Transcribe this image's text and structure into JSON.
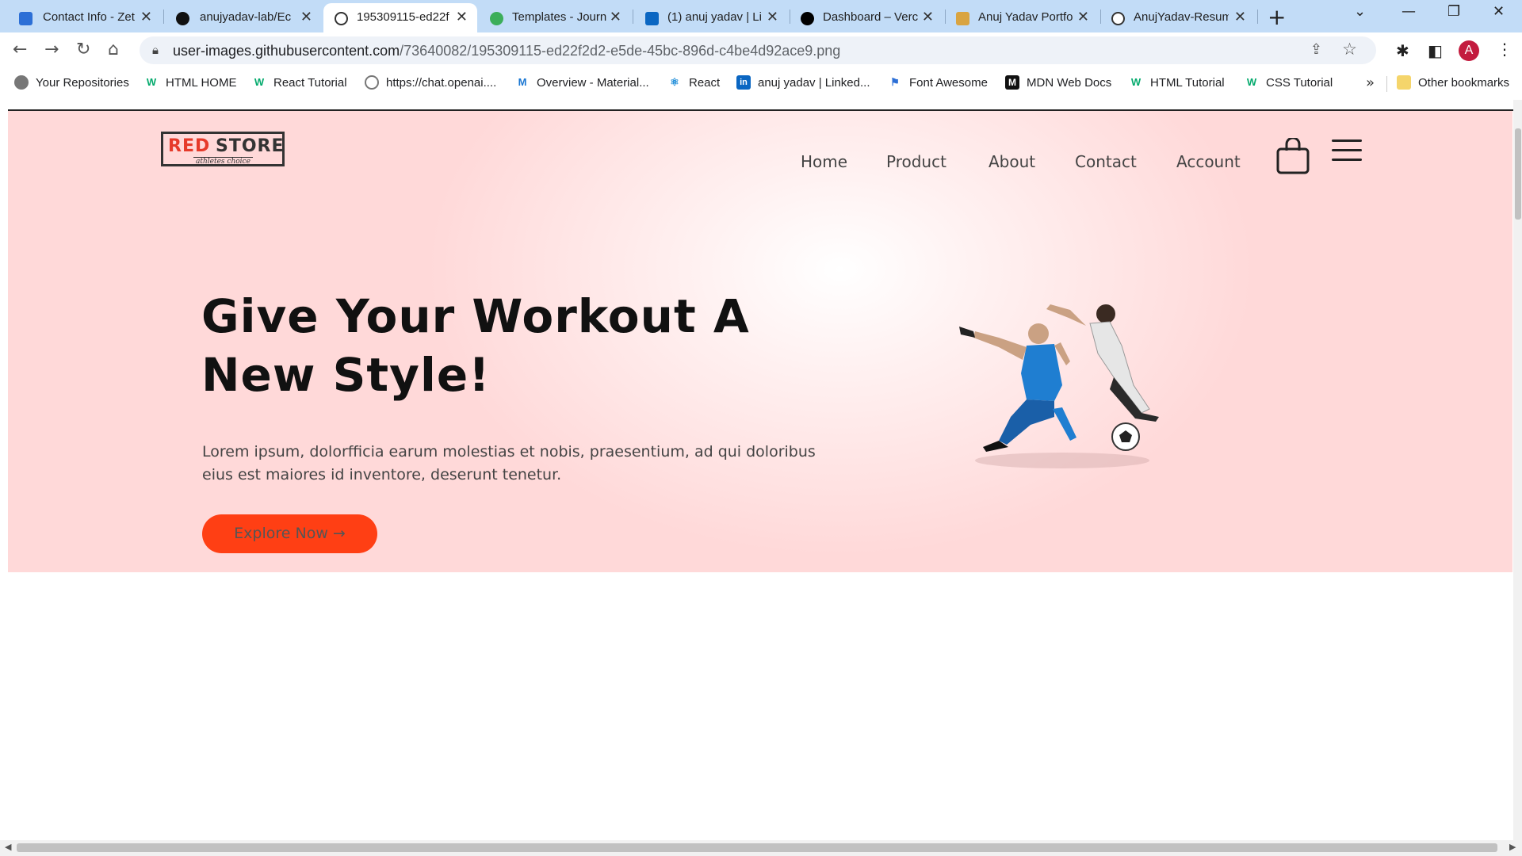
{
  "browser": {
    "tabs": [
      {
        "title": "Contact Info - Zet",
        "favicon": "zety-icon",
        "color": "#2c6fd6"
      },
      {
        "title": "anujyadav-lab/Ec",
        "favicon": "github-icon",
        "color": "#111111"
      },
      {
        "title": "195309115-ed22f",
        "favicon": "globe-icon",
        "color": "#333333",
        "active": true
      },
      {
        "title": "Templates - Journ",
        "favicon": "leaf-icon",
        "color": "#3cae5a"
      },
      {
        "title": "(1) anuj yadav | Li",
        "favicon": "linkedin-icon",
        "color": "#0a66c2"
      },
      {
        "title": "Dashboard – Verc",
        "favicon": "vercel-icon",
        "color": "#000000"
      },
      {
        "title": "Anuj Yadav Portfo",
        "favicon": "portfolio-icon",
        "color": "#d9a441"
      },
      {
        "title": "AnujYadav-Resum",
        "favicon": "globe-icon",
        "color": "#333333"
      }
    ],
    "new_tab_icon": "plus-icon",
    "url_host": "user-images.githubusercontent.com",
    "url_path": "/73640082/195309115-ed22f2d2-e5de-45bc-896d-c4be4d92ace9.png",
    "profile_initial": "A",
    "profile_color": "#c31b3e",
    "bookmarks": [
      {
        "label": "Your Repositories",
        "icon": "github-icon"
      },
      {
        "label": "HTML HOME",
        "icon": "w3schools-icon"
      },
      {
        "label": "React Tutorial",
        "icon": "w3schools-icon"
      },
      {
        "label": "https://chat.openai....",
        "icon": "openai-icon"
      },
      {
        "label": "Overview - Material...",
        "icon": "mui-icon"
      },
      {
        "label": "React",
        "icon": "react-icon"
      },
      {
        "label": "anuj yadav | Linked...",
        "icon": "linkedin-icon"
      },
      {
        "label": "Font Awesome",
        "icon": "flag-icon"
      },
      {
        "label": "MDN Web Docs",
        "icon": "mdn-icon"
      },
      {
        "label": "HTML Tutorial",
        "icon": "w3schools-icon"
      },
      {
        "label": "CSS Tutorial",
        "icon": "w3schools-icon"
      }
    ],
    "bookmarks_overflow": "»",
    "other_bookmarks": "Other bookmarks"
  },
  "site": {
    "logo_red": "RED",
    "logo_store": "STORE",
    "logo_tagline": "athletes choice",
    "nav": [
      "Home",
      "Product",
      "About",
      "Contact",
      "Account"
    ],
    "headline_line1": "Give Your Workout A",
    "headline_line2": "New Style!",
    "paragraph": "Lorem ipsum, dolorfficia earum molestias et nobis, praesentium, ad qui doloribus eius est maiores id inventore, deserunt tenetur.",
    "cta_label": "Explore Now →",
    "accent_color": "#ff3f14",
    "brand_red": "#e63a2a"
  }
}
